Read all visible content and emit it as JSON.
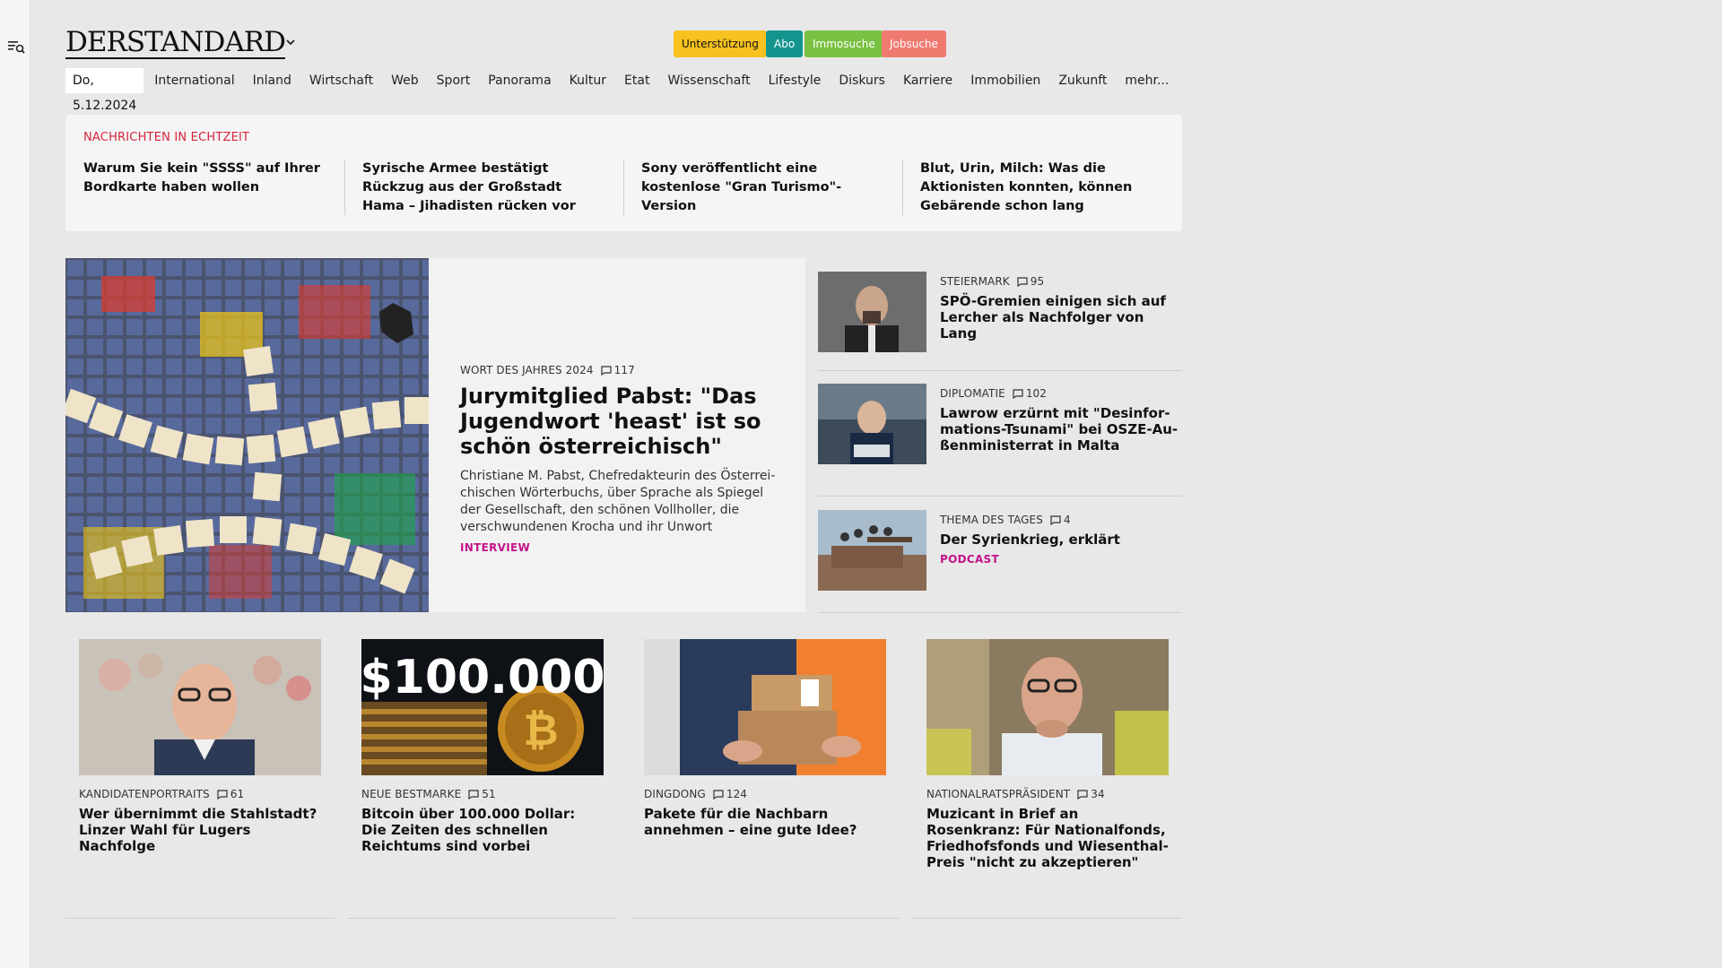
{
  "header": {
    "logo": "DERSTANDARD",
    "promos": [
      {
        "label": "Unterstützung",
        "bg": "#f7c21f",
        "color": "#111"
      },
      {
        "label": "Abo",
        "bg": "#13958e",
        "color": "#fff"
      },
      {
        "label": "Immosuche",
        "bg": "#79c142",
        "color": "#fff"
      },
      {
        "label": "Jobsuche",
        "bg": "#f07a70",
        "color": "#fff"
      }
    ],
    "date": "Do, 5.12.2024",
    "nav": [
      "International",
      "Inland",
      "Wirtschaft",
      "Web",
      "Sport",
      "Panorama",
      "Kultur",
      "Etat",
      "Wissenschaft",
      "Lifestyle",
      "Diskurs",
      "Karriere",
      "Immobilien",
      "Zukunft",
      "mehr..."
    ]
  },
  "live": {
    "title": "NACHRICHTEN IN ECHTZEIT",
    "items": [
      "Warum Sie kein \"SSSS\" auf Ihrer Bordkarte haben wollen",
      "Syrische Armee bestätigt Rückzug aus der Großstadt Hama – Jihadisten rü­cken vor",
      "Sony veröffentlicht eine kostenlose \"Gran Turismo\"-Version",
      "Blut, Urin, Milch: Was die Aktionisten konnten, können Gebärende schon lang"
    ]
  },
  "hero": {
    "kicker": "WORT DES JAHRES 2024",
    "comments": "117",
    "title": "Jurymitglied Pabst: \"Das Jugendwort 'heast' ist so schön österreichisch\"",
    "desc": "Christiane M. Pabst, Chefredakteurin des Österrei­chischen Wörterbuchs, über Sprache als Spiegel der Gesellschaft, den schönen Vollholler, die verschwundenen Krocha und ihr Unwort",
    "tag": "INTERVIEW"
  },
  "side": [
    {
      "kicker": "STEIERMARK",
      "comments": "95",
      "title": "SPÖ-Gremien einigen sich auf Lercher als Nachfolger von Lang",
      "tag": ""
    },
    {
      "kicker": "DIPLOMATIE",
      "comments": "102",
      "title": "Lawrow erzürnt mit \"Desinfor­mations-Tsunami\" bei OSZE-Au­ßenministerrat in Malta",
      "tag": ""
    },
    {
      "kicker": "THEMA DES TAGES",
      "comments": "4",
      "title": "Der Syrienkrieg, erklärt",
      "tag": "PODCAST"
    }
  ],
  "cards": [
    {
      "kicker": "KANDIDATENPORTRAITS",
      "comments": "61",
      "title": "Wer übernimmt die Stahlstadt? Linzer Wahl für Lugers Nachfolge"
    },
    {
      "kicker": "NEUE BESTMARKE",
      "comments": "51",
      "title": "Bitcoin über 100.000 Dollar: Die Zeiten des schnellen Reichtums sind vorbei",
      "img_text": "$100.000"
    },
    {
      "kicker": "DINGDONG",
      "comments": "124",
      "title": "Pakete für die Nachbarn annehmen – eine gute Idee?"
    },
    {
      "kicker": "NATIONALRATSPRÄSIDENT",
      "comments": "34",
      "title": "Muzicant in Brief an Rosenkranz: Für Nationalfonds, Friedhofsfonds und Wiesenthal-Preis \"nicht zu akzeptieren\""
    }
  ],
  "colors": {
    "live_title": "#d6243c",
    "tag": "#c4128a",
    "bg": "#e8e8e8"
  }
}
